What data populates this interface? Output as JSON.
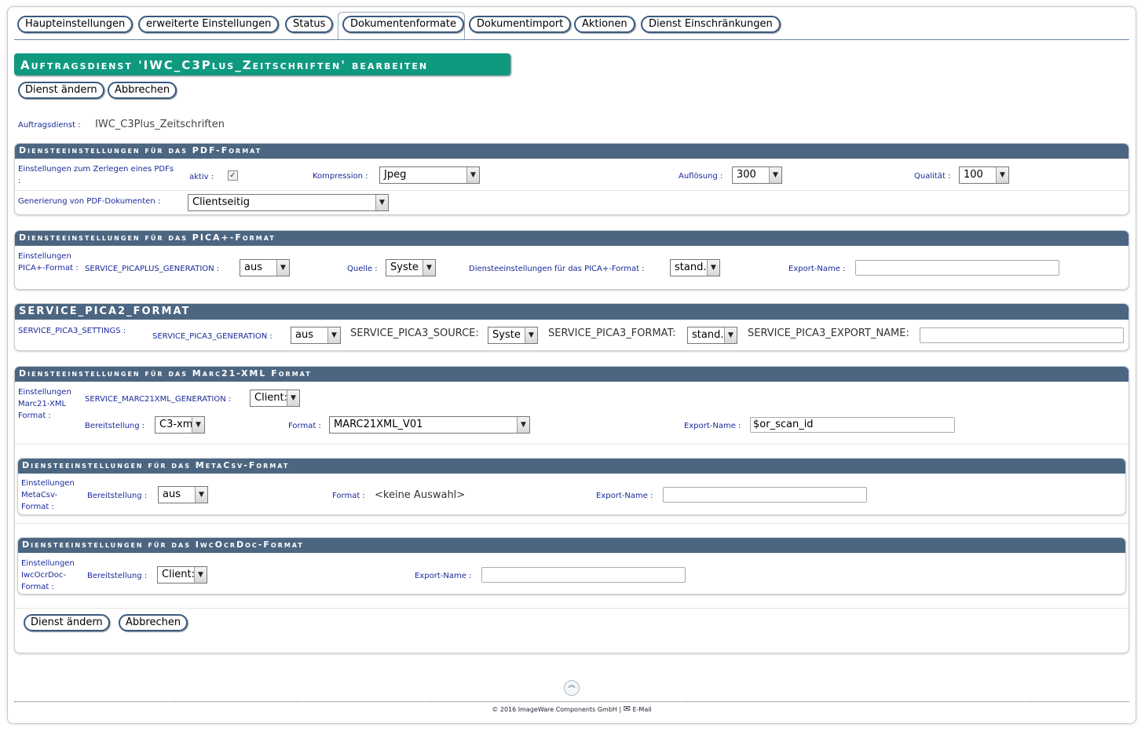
{
  "tabs": [
    {
      "label": "Haupteinstellungen"
    },
    {
      "label": "erweiterte Einstellungen"
    },
    {
      "label": "Status"
    },
    {
      "label": "Dokumentenformate"
    },
    {
      "label": "Dokumentimport"
    },
    {
      "label": "Aktionen"
    },
    {
      "label": "Dienst Einschränkungen"
    }
  ],
  "heading": "Auftragsdienst 'IWC_C3Plus_Zeitschriften' bearbeiten",
  "buttons": {
    "save": "Dienst ändern",
    "cancel": "Abbrechen"
  },
  "service": {
    "label": "Auftragsdienst :",
    "value": "IWC_C3Plus_Zeitschriften"
  },
  "pdf": {
    "title": "Diensteeinstellungen für das PDF-Format",
    "split_label": "Einstellungen zum Zerlegen eines PDFs :",
    "active_label": "aktiv :",
    "active_mark": "✓",
    "compression_label": "Kompression :",
    "compression_value": "Jpeg",
    "resolution_label": "Auflösung :",
    "resolution_value": "300",
    "quality_label": "Qualität :",
    "quality_value": "100",
    "generation_label": "Generierung von PDF-Dokumenten :",
    "generation_value": "Clientseitig"
  },
  "pica_plus": {
    "title": "Diensteeinstellungen für das PICA+-Format",
    "settings_label": "Einstellungen PICA+-Format :",
    "generation_label": "SERVICE_PICAPLUS_GENERATION :",
    "generation_value": "aus",
    "source_label": "Quelle :",
    "source_value": "Syste",
    "format_label": "Diensteeinstellungen für das PICA+-Format :",
    "format_value": "stand.",
    "export_label": "Export-Name :",
    "export_value": ""
  },
  "pica2": {
    "title": "SERVICE_PICA2_FORMAT",
    "settings_label": "SERVICE_PICA3_SETTINGS :",
    "generation_label": "SERVICE_PICA3_GENERATION :",
    "generation_value": "aus",
    "source_label": "SERVICE_PICA3_SOURCE:",
    "source_value": "Syste",
    "format_label": "SERVICE_PICA3_FORMAT:",
    "format_value": "stand.",
    "export_label": "SERVICE_PICA3_EXPORT_NAME:",
    "export_value": ""
  },
  "marc": {
    "title": "Diensteeinstellungen für das Marc21-XML Format",
    "settings_label": "Einstellungen Marc21-XML Format :",
    "generation_label": "SERVICE_MARC21XML_GENERATION :",
    "generation_value": "Client:",
    "provision_label": "Bereitstellung :",
    "provision_value": "C3-xm",
    "format_label": "Format :",
    "format_value": "MARC21XML_V01",
    "export_label": "Export-Name :",
    "export_value": "$or_scan_id"
  },
  "metacsv": {
    "title": "Diensteeinstellungen für das MetaCsv-Format",
    "settings_label": "Einstellungen MetaCsv-Format :",
    "provision_label": "Bereitstellung :",
    "provision_value": "aus",
    "format_label": "Format :",
    "format_value": "<keine Auswahl>",
    "export_label": "Export-Name :",
    "export_value": ""
  },
  "iwcocr": {
    "title": "Diensteeinstellungen für das IwcOcrDoc-Format",
    "settings_label": "Einstellungen IwcOcrDoc-Format :",
    "provision_label": "Bereitstellung :",
    "provision_value": "Client:",
    "export_label": "Export-Name :",
    "export_value": ""
  },
  "footer": {
    "copyright": "© 2016 ImageWare Components GmbH |",
    "email": "E-Mail"
  },
  "icons": {
    "arrow": "▼",
    "up": "︽",
    "mail": "✉"
  }
}
